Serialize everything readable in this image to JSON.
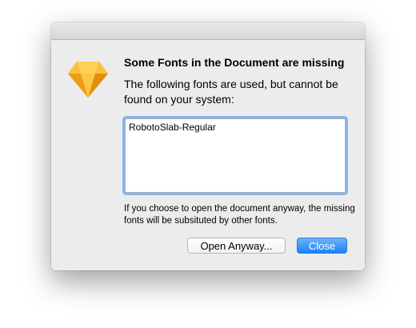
{
  "dialog": {
    "app_icon": "sketch-diamond-icon",
    "heading": "Some Fonts in the Document are missing",
    "message": "The following fonts are used, but cannot be found on your system:",
    "missing_fonts": "RobotoSlab-Regular",
    "note": "If you choose to open the document anyway, the missing fonts will be subsituted by other fonts.",
    "open_anyway_label": "Open Anyway...",
    "close_label": "Close"
  },
  "colors": {
    "dialog_background": "#ececec",
    "default_button": "#1a82fb",
    "focus_ring": "#86b4ee",
    "icon_gold": "#f5b731"
  }
}
